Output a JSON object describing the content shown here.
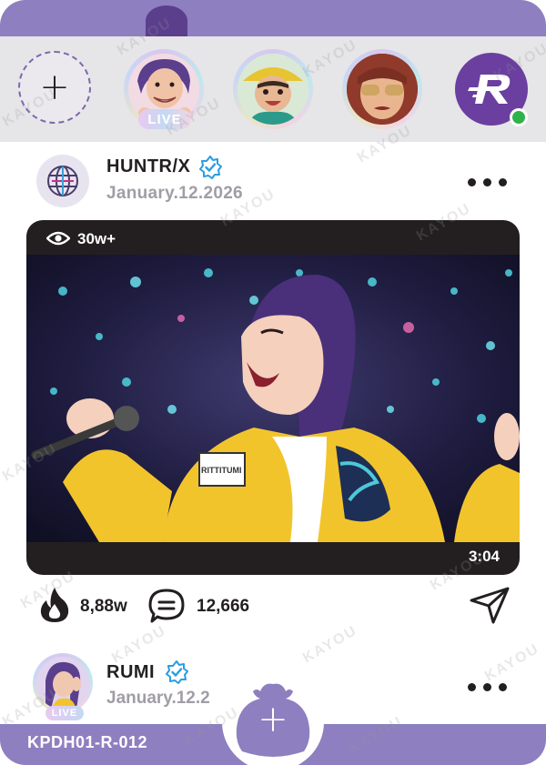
{
  "stories": {
    "add_label": "+",
    "live_label": "LIVE",
    "items": [
      {
        "name": "story-avatar-1",
        "live": true
      },
      {
        "name": "story-avatar-2",
        "live": false
      },
      {
        "name": "story-avatar-3",
        "live": false
      }
    ],
    "brand_online": true
  },
  "post": {
    "author": "HUNTR/X",
    "verified": true,
    "date": "January.12.2026",
    "views": "30w+",
    "duration": "3:04",
    "likes": "8,88w",
    "comments": "12,666",
    "jacket_text": "RITTITUMI"
  },
  "next_post": {
    "author": "RUMI",
    "verified": true,
    "date": "January.12.2",
    "live_label": "LIVE"
  },
  "footer": {
    "card_code": "KPDH01-R-012",
    "fab_label": "+"
  },
  "watermark": "KAYOU",
  "colors": {
    "brand_purple": "#8e7fc0",
    "stories_bg": "#e6e5e8",
    "text_dark": "#231f20",
    "date_gray": "#a19da6",
    "online_green": "#2eb34a",
    "verified_blue": "#2a9de0",
    "media_frame": "#231f20"
  }
}
